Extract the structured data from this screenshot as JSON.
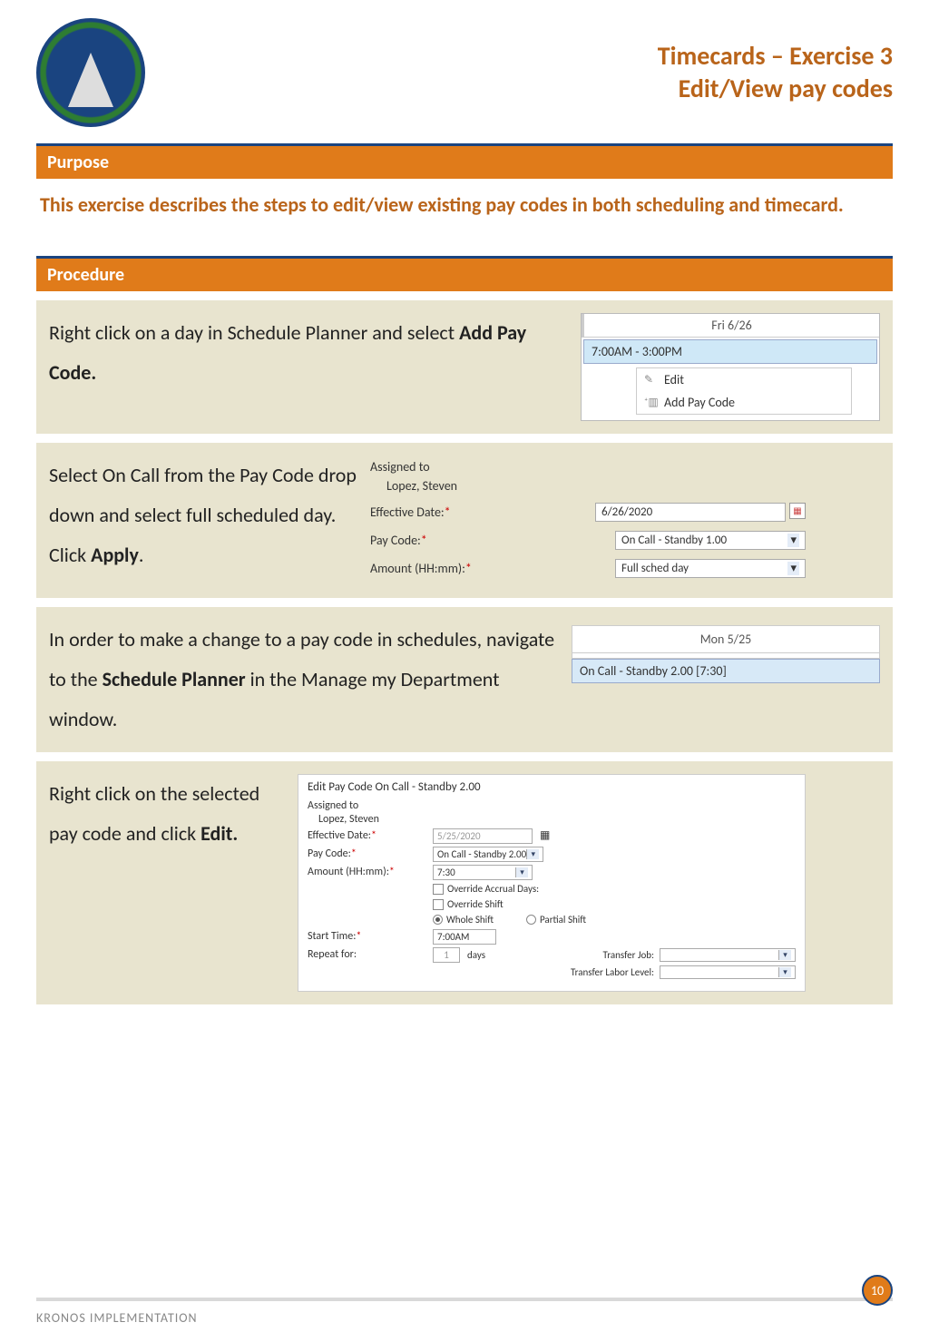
{
  "header": {
    "title_line1": "Timecards – Exercise 3",
    "title_line2": "Edit/View pay codes"
  },
  "sections": {
    "purpose_label": "Purpose",
    "procedure_label": "Procedure"
  },
  "intro": "This exercise describes the steps to edit/view existing pay codes in both scheduling and timecard.",
  "step1": {
    "text_a": "Right click on a day in Schedule Planner and select ",
    "text_b": "Add Pay Code."
  },
  "mock1": {
    "day": "Fri 6/26",
    "shift": "7:00AM - 3:00PM",
    "menu_edit": "Edit",
    "menu_add": "Add Pay Code"
  },
  "step2": {
    "text_a": "Select On Call from the Pay Code drop down and select full scheduled day. Click ",
    "text_b": "Apply",
    "text_c": "."
  },
  "mock2": {
    "assigned_label": "Assigned to",
    "assigned_value": "Lopez, Steven",
    "eff_label": "Effective Date:",
    "eff_value": "6/26/2020",
    "code_label": "Pay Code:",
    "code_value": "On Call - Standby 1.00",
    "amt_label": "Amount (HH:mm):",
    "amt_value": "Full sched day"
  },
  "step3": {
    "text_a": "In order to make a change to a pay code in schedules, navigate to the ",
    "text_b": "Schedule Planner",
    "text_c": " in the Manage my Department window."
  },
  "mock3": {
    "day": "Mon 5/25",
    "entry": "On Call - Standby 2.00  [7:30]"
  },
  "step4": {
    "text_a": "Right click on the selected pay code and click ",
    "text_b": "Edit."
  },
  "mock4": {
    "title": "Edit Pay Code On Call - Standby 2.00",
    "assigned_label": "Assigned to",
    "assigned_value": "Lopez, Steven",
    "eff_label": "Effective Date:",
    "eff_value": "5/25/2020",
    "code_label": "Pay Code:",
    "code_value": "On Call - Standby 2.00",
    "amt_label": "Amount (HH:mm):",
    "amt_value": "7:30",
    "override_accrual": "Override Accrual Days:",
    "override_shift": "Override Shift",
    "whole_shift": "Whole Shift",
    "partial_shift": "Partial Shift",
    "start_label": "Start Time:",
    "start_value": "7:00AM",
    "repeat_label": "Repeat for:",
    "repeat_value": "1",
    "repeat_unit": "days",
    "transfer_job_label": "Transfer Job:",
    "transfer_labor_label": "Transfer Labor Level:"
  },
  "footer": {
    "text": "KRONOS IMPLEMENTATION",
    "page": "10"
  }
}
